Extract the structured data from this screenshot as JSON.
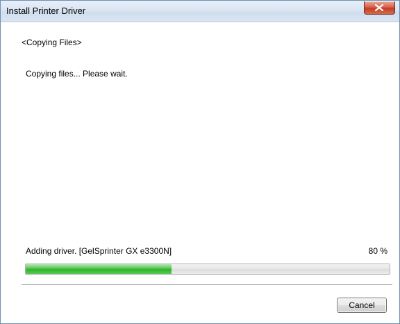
{
  "window": {
    "title": "Install Printer Driver"
  },
  "content": {
    "section_title": "<Copying Files>",
    "message": "Copying files... Please wait.",
    "status_text": "Adding driver. [GelSprinter GX e3300N]",
    "percent_label": "80 %",
    "progress_fraction": 0.4
  },
  "buttons": {
    "cancel_label": "Cancel"
  },
  "icons": {
    "close": "close-icon"
  },
  "colors": {
    "progress_fill": "#2fb52a",
    "close_button": "#c23e23"
  }
}
